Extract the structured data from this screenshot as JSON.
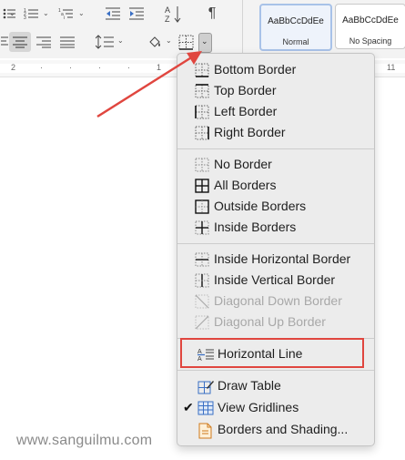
{
  "ribbon": {
    "styles": [
      {
        "sample": "AaBbCcDdEe",
        "name": "Normal",
        "selected": true
      },
      {
        "sample": "AaBbCcDdEe",
        "name": "No Spacing",
        "selected": false
      }
    ],
    "icons": [
      "bullets-icon",
      "numbering-icon",
      "multilevel-list-icon",
      "decrease-indent-icon",
      "increase-indent-icon",
      "sort-icon",
      "pilcrow-icon",
      "align-left-icon",
      "align-center-icon",
      "align-right-icon",
      "justify-icon",
      "line-spacing-icon",
      "shading-icon",
      "borders-icon",
      "borders-dropdown-icon"
    ]
  },
  "ruler": {
    "numbers": [
      "2",
      "1",
      "11"
    ]
  },
  "menu": {
    "groups": [
      [
        {
          "label": "Bottom Border",
          "icon": "bottom-border-icon",
          "enabled": true
        },
        {
          "label": "Top Border",
          "icon": "top-border-icon",
          "enabled": true
        },
        {
          "label": "Left Border",
          "icon": "left-border-icon",
          "enabled": true
        },
        {
          "label": "Right Border",
          "icon": "right-border-icon",
          "enabled": true
        }
      ],
      [
        {
          "label": "No Border",
          "icon": "no-border-icon",
          "enabled": true
        },
        {
          "label": "All Borders",
          "icon": "all-borders-icon",
          "enabled": true
        },
        {
          "label": "Outside Borders",
          "icon": "outside-borders-icon",
          "enabled": true
        },
        {
          "label": "Inside Borders",
          "icon": "inside-borders-icon",
          "enabled": true
        }
      ],
      [
        {
          "label": "Inside Horizontal Border",
          "icon": "inside-horizontal-border-icon",
          "enabled": true
        },
        {
          "label": "Inside Vertical Border",
          "icon": "inside-vertical-border-icon",
          "enabled": true
        },
        {
          "label": "Diagonal Down Border",
          "icon": "diagonal-down-border-icon",
          "enabled": false
        },
        {
          "label": "Diagonal Up Border",
          "icon": "diagonal-up-border-icon",
          "enabled": false
        }
      ],
      [
        {
          "label": "Horizontal Line",
          "icon": "horizontal-line-icon",
          "enabled": true,
          "highlighted": true
        }
      ],
      [
        {
          "label": "Draw Table",
          "icon": "draw-table-icon",
          "enabled": true
        },
        {
          "label": "View Gridlines",
          "icon": "view-gridlines-icon",
          "enabled": true,
          "checked": true
        },
        {
          "label": "Borders and Shading...",
          "icon": "borders-and-shading-icon",
          "enabled": true
        }
      ]
    ]
  },
  "annotation": {
    "highlight_color": "#e0463f"
  },
  "watermark": "www.sanguilmu.com"
}
